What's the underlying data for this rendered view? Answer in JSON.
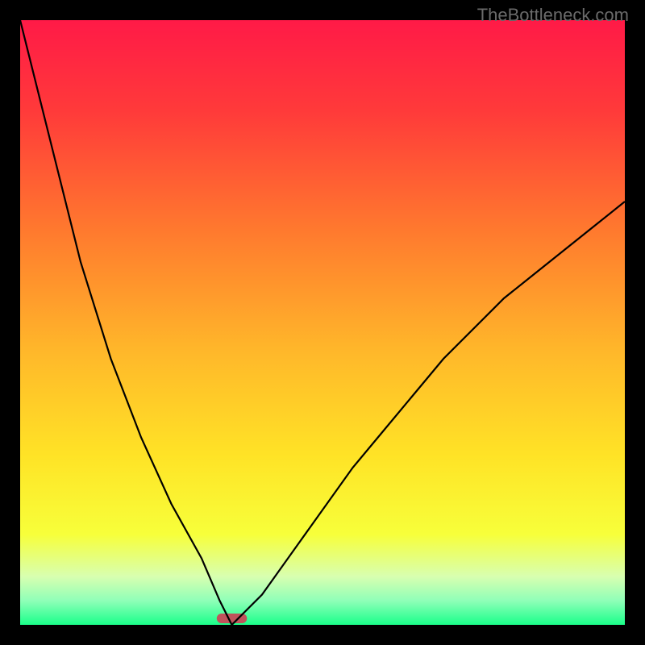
{
  "watermark": "TheBottleneck.com",
  "chart_data": {
    "type": "line",
    "title": "",
    "xlabel": "",
    "ylabel": "",
    "xlim": [
      0,
      100
    ],
    "ylim": [
      0,
      100
    ],
    "x": [
      0,
      5,
      10,
      15,
      20,
      25,
      30,
      33,
      35,
      37,
      40,
      45,
      50,
      55,
      60,
      65,
      70,
      75,
      80,
      85,
      90,
      95,
      100
    ],
    "values": [
      100,
      80,
      60,
      44,
      31,
      20,
      11,
      4,
      0,
      2,
      5,
      12,
      19,
      26,
      32,
      38,
      44,
      49,
      54,
      58,
      62,
      66,
      70
    ],
    "minimum_x": 35,
    "background": {
      "type": "vertical-gradient",
      "stops": [
        {
          "pos": 0.0,
          "color": "#ff1a47"
        },
        {
          "pos": 0.15,
          "color": "#ff3a3a"
        },
        {
          "pos": 0.35,
          "color": "#ff7a2e"
        },
        {
          "pos": 0.55,
          "color": "#ffb82a"
        },
        {
          "pos": 0.72,
          "color": "#ffe326"
        },
        {
          "pos": 0.85,
          "color": "#f7ff3a"
        },
        {
          "pos": 0.92,
          "color": "#d8ffb0"
        },
        {
          "pos": 0.96,
          "color": "#8fffb8"
        },
        {
          "pos": 1.0,
          "color": "#1aff8a"
        }
      ]
    },
    "marker": {
      "x": 35,
      "y": 0.5,
      "width_pct": 5,
      "color": "#c0535b"
    },
    "curve_color": "#000000"
  }
}
